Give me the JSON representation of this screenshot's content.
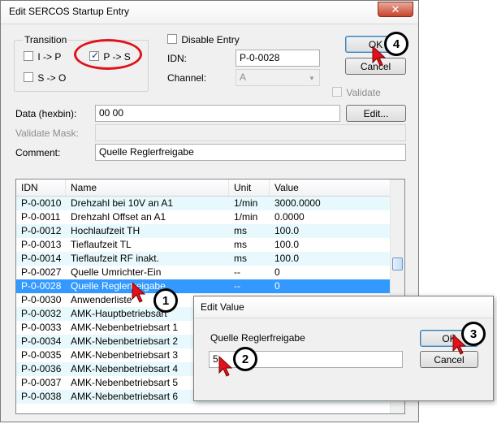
{
  "dialog": {
    "title": "Edit SERCOS Startup Entry",
    "close_glyph": "✕",
    "transition": {
      "label": "Transition",
      "options": [
        {
          "label": "I -> P",
          "checked": false
        },
        {
          "label": "P -> S",
          "checked": true
        },
        {
          "label": "S -> O",
          "checked": false
        }
      ]
    },
    "disable_entry": {
      "label": "Disable Entry",
      "checked": false
    },
    "idn": {
      "label": "IDN:",
      "value": "P-0-0028"
    },
    "channel": {
      "label": "Channel:",
      "value": "A"
    },
    "validate": {
      "label": "Validate",
      "checked": false
    },
    "ok_label": "OK",
    "cancel_label": "Cancel",
    "data": {
      "label": "Data (hexbin):",
      "value": "00 00"
    },
    "edit_label": "Edit...",
    "validate_mask": {
      "label": "Validate Mask:",
      "value": ""
    },
    "comment": {
      "label": "Comment:",
      "value": "Quelle Reglerfreigabe"
    }
  },
  "table": {
    "columns": [
      "IDN",
      "Name",
      "Unit",
      "Value"
    ],
    "rows": [
      {
        "idn": "P-0-0010",
        "name": "Drehzahl bei 10V an A1",
        "unit": "1/min",
        "value": "3000.0000"
      },
      {
        "idn": "P-0-0011",
        "name": "Drehzahl Offset an A1",
        "unit": "1/min",
        "value": "0.0000"
      },
      {
        "idn": "P-0-0012",
        "name": "Hochlaufzeit TH",
        "unit": "ms",
        "value": "100.0"
      },
      {
        "idn": "P-0-0013",
        "name": "Tieflaufzeit TL",
        "unit": "ms",
        "value": "100.0"
      },
      {
        "idn": "P-0-0014",
        "name": "Tieflaufzeit RF inakt.",
        "unit": "ms",
        "value": "100.0"
      },
      {
        "idn": "P-0-0027",
        "name": "Quelle Umrichter-Ein",
        "unit": "--",
        "value": "0"
      },
      {
        "idn": "P-0-0028",
        "name": "Quelle Reglerfreigabe",
        "unit": "--",
        "value": "0"
      },
      {
        "idn": "P-0-0030",
        "name": "Anwenderliste",
        "unit": "",
        "value": ""
      },
      {
        "idn": "P-0-0032",
        "name": "AMK-Hauptbetriebsart",
        "unit": "",
        "value": ""
      },
      {
        "idn": "P-0-0033",
        "name": "AMK-Nebenbetriebsart 1",
        "unit": "",
        "value": ""
      },
      {
        "idn": "P-0-0034",
        "name": "AMK-Nebenbetriebsart 2",
        "unit": "",
        "value": ""
      },
      {
        "idn": "P-0-0035",
        "name": "AMK-Nebenbetriebsart 3",
        "unit": "",
        "value": ""
      },
      {
        "idn": "P-0-0036",
        "name": "AMK-Nebenbetriebsart 4",
        "unit": "",
        "value": ""
      },
      {
        "idn": "P-0-0037",
        "name": "AMK-Nebenbetriebsart 5",
        "unit": "",
        "value": ""
      },
      {
        "idn": "P-0-0038",
        "name": "AMK-Nebenbetriebsart 6",
        "unit": "",
        "value": ""
      }
    ],
    "selected_index": 6
  },
  "edit_value": {
    "title": "Edit Value",
    "label": "Quelle Reglerfreigabe",
    "value": "5",
    "ok_label": "OK",
    "cancel_label": "Cancel"
  },
  "callouts": [
    "1",
    "2",
    "3",
    "4"
  ],
  "colors": {
    "selection": "#3399ff",
    "highlight_oval": "#e0121b",
    "alt_row": "#e8f9fd"
  }
}
